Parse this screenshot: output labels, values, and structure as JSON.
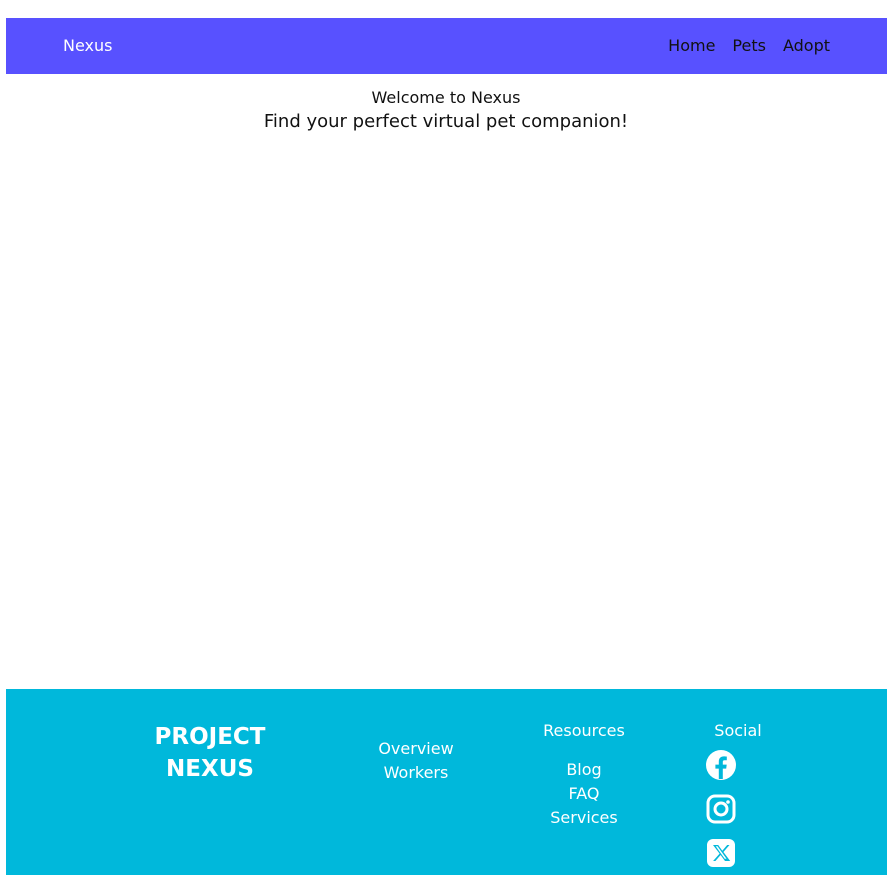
{
  "header": {
    "brand": "Nexus",
    "nav": [
      "Home",
      "Pets",
      "Adopt"
    ]
  },
  "hero": {
    "title": "Welcome to Nexus",
    "subtitle": "Find your perfect virtual pet companion!"
  },
  "footer": {
    "brand_line1": "PROJECT",
    "brand_line2": "NEXUS",
    "links_col1": [
      "Overview",
      "Workers"
    ],
    "resources_heading": "Resources",
    "resources": [
      "Blog",
      "FAQ",
      "Services"
    ],
    "social_heading": "Social",
    "social_icons": [
      "facebook-icon",
      "instagram-icon",
      "x-icon"
    ]
  },
  "colors": {
    "header_bg": "#5851ff",
    "footer_bg": "#00b8db"
  }
}
